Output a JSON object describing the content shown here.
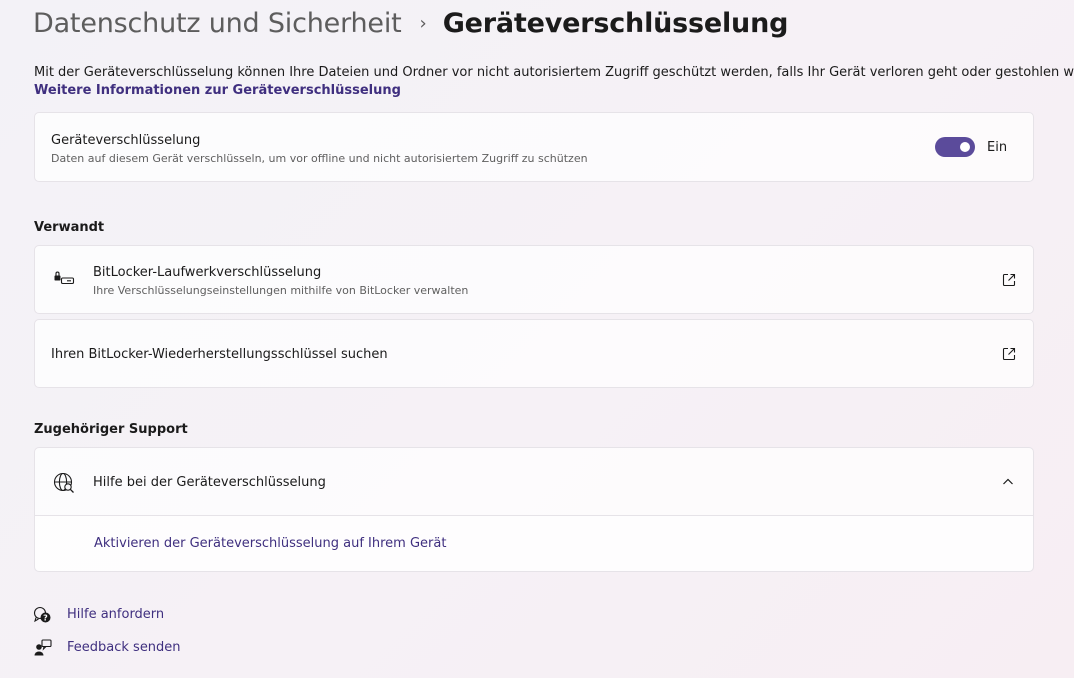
{
  "breadcrumb": {
    "parent": "Datenschutz und Sicherheit",
    "separator": "›",
    "current": "Geräteverschlüsselung"
  },
  "intro": {
    "text": "Mit der Geräteverschlüsselung können Ihre Dateien und Ordner vor nicht autorisiertem Zugriff geschützt werden, falls Ihr Gerät verloren geht oder gestohlen wird.",
    "link": "Weitere Informationen zur Geräteverschlüsselung"
  },
  "device_encryption": {
    "title": "Geräteverschlüsselung",
    "subtitle": "Daten auf diesem Gerät verschlüsseln, um vor offline und nicht autorisiertem Zugriff zu schützen",
    "toggle_state": "Ein",
    "toggle_on": true
  },
  "related": {
    "heading": "Verwandt",
    "items": [
      {
        "title": "BitLocker-Laufwerkverschlüsselung",
        "subtitle": "Ihre Verschlüsselungseinstellungen mithilfe von BitLocker verwalten",
        "icon": "drive-lock-icon"
      },
      {
        "title": "Ihren BitLocker-Wiederherstellungsschlüssel suchen"
      }
    ]
  },
  "support": {
    "heading": "Zugehöriger Support",
    "expander_title": "Hilfe bei der Geräteverschlüsselung",
    "expander_icon": "globe-search-icon",
    "expanded": true,
    "links": [
      "Aktivieren der Geräteverschlüsselung auf Ihrem Gerät"
    ]
  },
  "footer": {
    "help": "Hilfe anfordern",
    "feedback": "Feedback senden"
  },
  "colors": {
    "accent": "#5b4b9b",
    "link": "#3f2f7f"
  }
}
